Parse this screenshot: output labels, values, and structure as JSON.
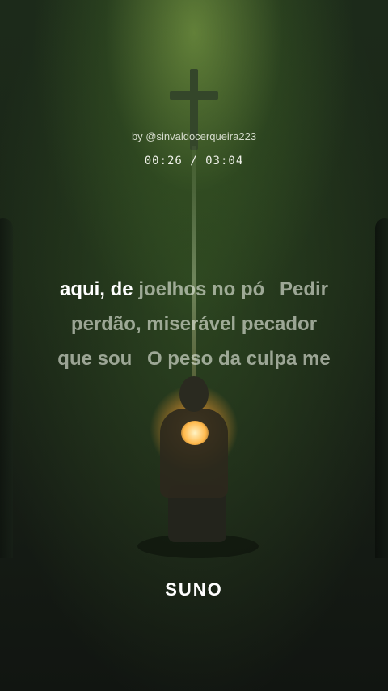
{
  "header": {
    "author": "by @sinvaldocerqueira223",
    "time": "00:26 / 03:04"
  },
  "lyrics": {
    "line1_sung": "aqui, de",
    "line1_rest_a": "joelhos no pó",
    "line1_rest_b": "Pedir",
    "line2": "perdão, miserável pecador",
    "line3_a": "que sou",
    "line3_b": "O peso da culpa me"
  },
  "brand": {
    "logo": "SUNO"
  },
  "colors": {
    "sung_text": "#ffffff",
    "unsung_text": "#b9bdb3",
    "background": "#1a2617",
    "glow": "#ffb84a"
  },
  "icons": [
    "cross-icon"
  ]
}
